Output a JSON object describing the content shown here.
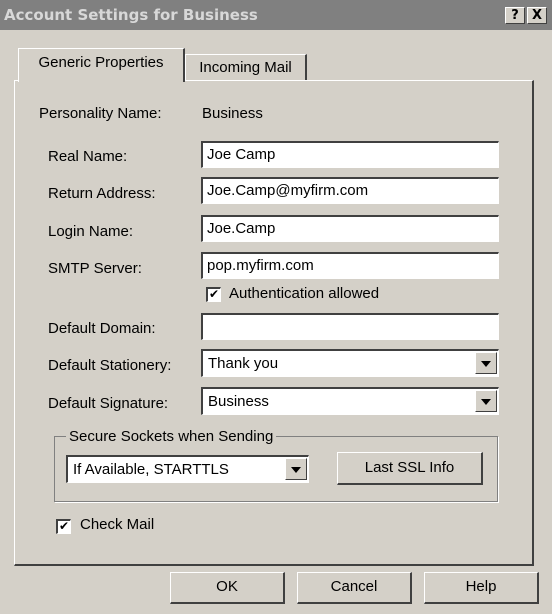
{
  "window": {
    "title": "Account Settings for Business",
    "help_button": "?",
    "close_button": "X"
  },
  "tabs": [
    {
      "label": "Generic Properties",
      "active": true
    },
    {
      "label": "Incoming Mail",
      "active": false
    }
  ],
  "form": {
    "personality_label": "Personality Name:",
    "personality_value": "Business",
    "real_name_label": "Real Name:",
    "real_name_value": "Joe Camp",
    "return_address_label": "Return Address:",
    "return_address_value": "Joe.Camp@myfirm.com",
    "login_name_label": "Login Name:",
    "login_name_value": "Joe.Camp",
    "smtp_server_label": "SMTP Server:",
    "smtp_server_value": "pop.myfirm.com",
    "auth_allowed_label": "Authentication allowed",
    "auth_allowed_checked": true,
    "default_domain_label": "Default Domain:",
    "default_domain_value": "",
    "default_stationery_label": "Default Stationery:",
    "default_stationery_value": "Thank you",
    "default_signature_label": "Default Signature:",
    "default_signature_value": "Business",
    "ssl_group_label": "Secure Sockets when Sending",
    "ssl_option_value": "If Available, STARTTLS",
    "last_ssl_button": "Last SSL Info",
    "check_mail_label": "Check Mail",
    "check_mail_checked": true
  },
  "footer": {
    "ok": "OK",
    "cancel": "Cancel",
    "help": "Help"
  },
  "icons": {
    "checkmark": "✔"
  }
}
